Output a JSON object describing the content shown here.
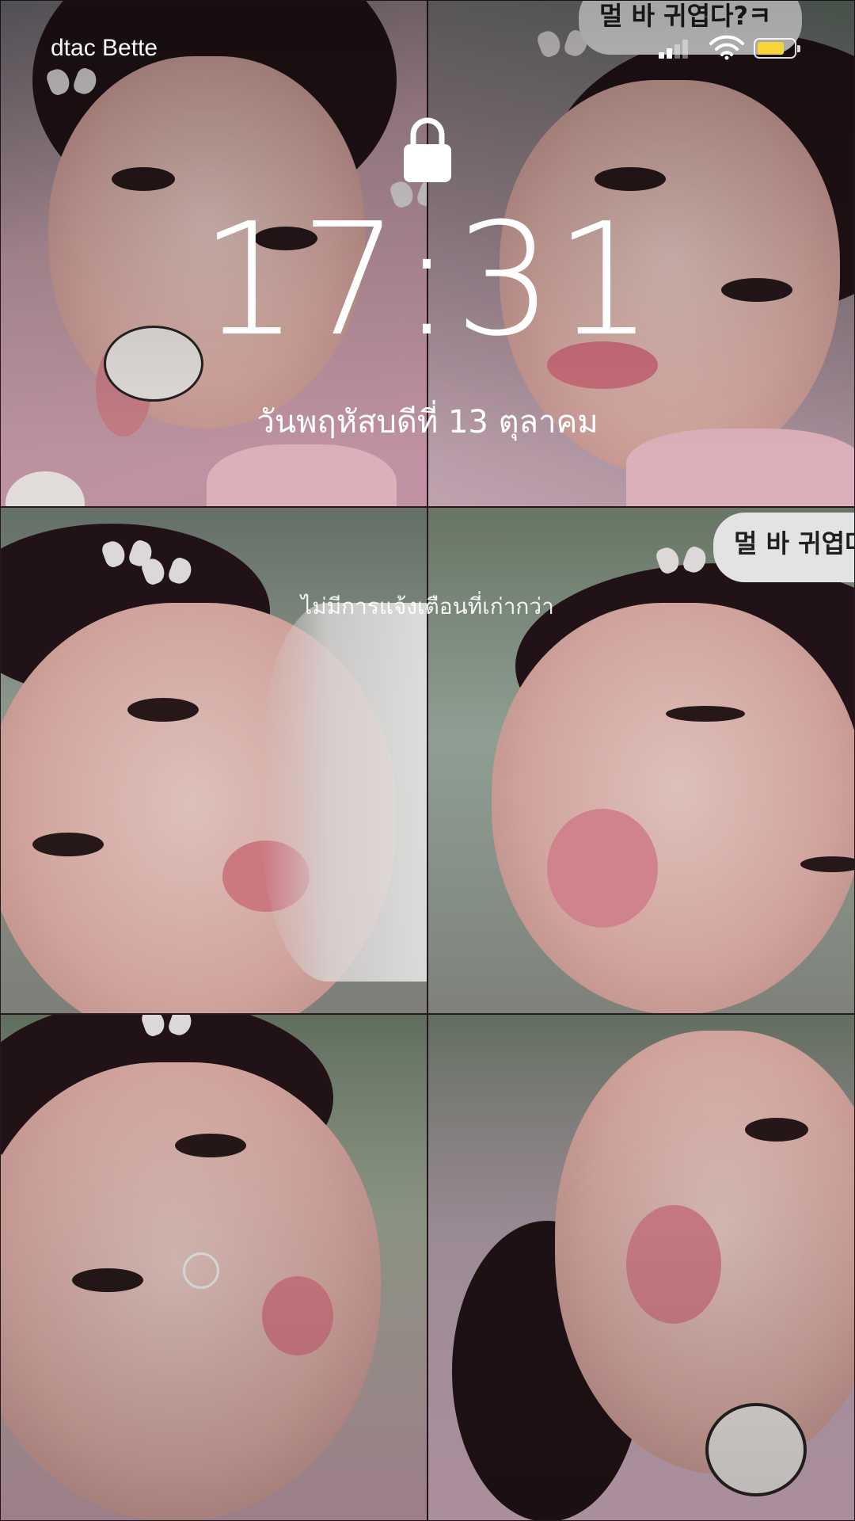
{
  "status_bar": {
    "carrier": "dtac Bette",
    "signal_icon": "cellular-signal-icon",
    "wifi_icon": "wifi-icon",
    "battery_icon": "battery-icon",
    "battery_level": 0.75,
    "battery_color": "#f7d538"
  },
  "lock_screen": {
    "lock_icon": "lock-icon",
    "time": "17:31",
    "date": "วันพฤหัสบดีที่ 13 ตุลาคม",
    "no_older_notifications": "ไม่มีการแจ้งเตือนที่เก่ากว่า"
  },
  "wallpaper": {
    "bubble_top": "멀 바 귀엽다?ㅋ",
    "bubble_middle": "멀 바 귀엽다"
  }
}
